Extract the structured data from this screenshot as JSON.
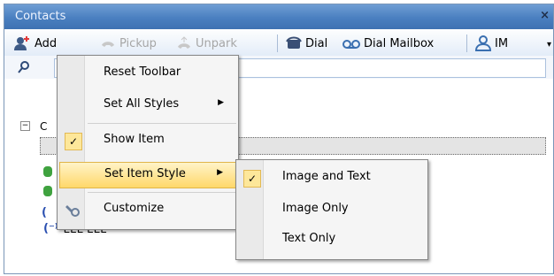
{
  "window": {
    "title": "Contacts",
    "close_glyph": "×"
  },
  "toolbar": {
    "add_label": "Add",
    "pickup_label": "Pickup",
    "unpark_label": "Unpark",
    "dial_label": "Dial",
    "dial_mailbox_label": "Dial Mailbox",
    "im_label": "IM"
  },
  "search": {
    "value": "",
    "placeholder": ""
  },
  "tree": {
    "group_label": "C",
    "contacts": [
      {
        "name": "EEE EEE",
        "icon": "phone-icon"
      }
    ]
  },
  "context_menu": {
    "items": [
      {
        "label": "Reset Toolbar"
      },
      {
        "label": "Set All Styles",
        "submenu": true
      },
      {
        "label": "Show Item",
        "checked": true
      },
      {
        "label": "Set Item Style",
        "submenu": true,
        "highlighted": true
      },
      {
        "label": "Customize",
        "icon": "wrench-icon"
      }
    ]
  },
  "submenu": {
    "items": [
      {
        "label": "Image and Text",
        "checked": true
      },
      {
        "label": "Image Only"
      },
      {
        "label": "Text Only"
      }
    ]
  },
  "colors": {
    "accent": "#4a7fc0",
    "highlight": "#ffd86a",
    "check": "#fde79a"
  }
}
